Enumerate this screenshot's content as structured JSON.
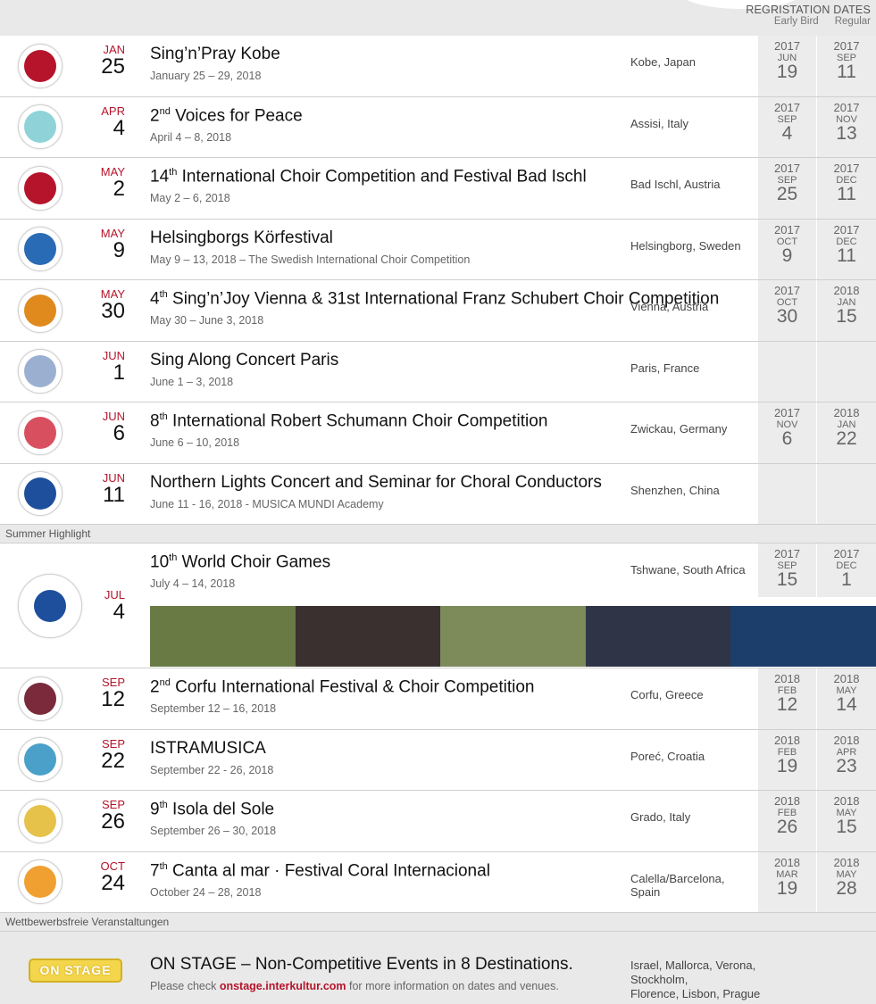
{
  "header": {
    "reg_title": "REGRISTATION DATES",
    "early_bird": "Early Bird",
    "regular": "Regular"
  },
  "events": [
    {
      "mon": "JAN",
      "day": "25",
      "title": "Sing’n’Pray Kobe",
      "sup": "",
      "rest": "",
      "sub": "January 25 – 29, 2018",
      "loc": "Kobe, Japan",
      "eb": {
        "y": "2017",
        "m": "JUN",
        "d": "19"
      },
      "rg": {
        "y": "2017",
        "m": "SEP",
        "d": "11"
      },
      "logo": "#b5142b"
    },
    {
      "mon": "APR",
      "day": "4",
      "title": "2",
      "sup": "nd",
      "rest": " Voices for Peace",
      "sub": "April 4 – 8, 2018",
      "loc": "Assisi, Italy",
      "eb": {
        "y": "2017",
        "m": "SEP",
        "d": "4"
      },
      "rg": {
        "y": "2017",
        "m": "NOV",
        "d": "13"
      },
      "logo": "#8fd3d9"
    },
    {
      "mon": "MAY",
      "day": "2",
      "title": "14",
      "sup": "th",
      "rest": " International Choir Competition and Festival Bad Ischl",
      "sub": "May 2 – 6, 2018",
      "loc": "Bad Ischl, Austria",
      "eb": {
        "y": "2017",
        "m": "SEP",
        "d": "25"
      },
      "rg": {
        "y": "2017",
        "m": "DEC",
        "d": "11"
      },
      "logo": "#b5142b"
    },
    {
      "mon": "MAY",
      "day": "9",
      "title": "Helsingborgs Körfestival",
      "sup": "",
      "rest": "",
      "sub": "May 9 – 13, 2018 – The Swedish International Choir Competition",
      "loc": "Helsingborg, Sweden",
      "eb": {
        "y": "2017",
        "m": "OCT",
        "d": "9"
      },
      "rg": {
        "y": "2017",
        "m": "DEC",
        "d": "11"
      },
      "logo": "#2a6bb5"
    },
    {
      "mon": "MAY",
      "day": "30",
      "title": "4",
      "sup": "th",
      "rest": " Sing’n’Joy Vienna & 31st International Franz Schubert Choir Competition",
      "sub": "May 30 – June 3, 2018",
      "loc": "Vienna, Austria",
      "eb": {
        "y": "2017",
        "m": "OCT",
        "d": "30"
      },
      "rg": {
        "y": "2018",
        "m": "JAN",
        "d": "15"
      },
      "logo": "#e08a1e"
    },
    {
      "mon": "JUN",
      "day": "1",
      "title": "Sing Along Concert Paris",
      "sup": "",
      "rest": "",
      "sub": "June 1 – 3, 2018",
      "loc": "Paris, France",
      "eb": null,
      "rg": null,
      "logo": "#9bb0d0"
    },
    {
      "mon": "JUN",
      "day": "6",
      "title": "8",
      "sup": "th",
      "rest": " International Robert Schumann Choir Competition",
      "sub": "June 6 – 10, 2018",
      "loc": "Zwickau, Germany",
      "eb": {
        "y": "2017",
        "m": "NOV",
        "d": "6"
      },
      "rg": {
        "y": "2018",
        "m": "JAN",
        "d": "22"
      },
      "logo": "#d85060"
    },
    {
      "mon": "JUN",
      "day": "11",
      "title": "Northern Lights Concert and Seminar for Choral Conductors",
      "sup": "",
      "rest": "",
      "sub": "June 11 - 16, 2018 - MUSICA MUNDI Academy",
      "loc": "Shenzhen, China",
      "eb": null,
      "rg": null,
      "logo": "#1d4f9c"
    }
  ],
  "summer_label": "Summer Highlight",
  "highlight": {
    "mon": "JUL",
    "day": "4",
    "title": "10",
    "sup": "th",
    "rest": " World Choir Games",
    "sub": "July 4 – 14, 2018",
    "loc": "Tshwane, South Africa",
    "eb": {
      "y": "2017",
      "m": "SEP",
      "d": "15"
    },
    "rg": {
      "y": "2017",
      "m": "DEC",
      "d": "1"
    }
  },
  "events2": [
    {
      "mon": "SEP",
      "day": "12",
      "title": "2",
      "sup": "nd",
      "rest": " Corfu International Festival & Choir Competition",
      "sub": "September 12 – 16, 2018",
      "loc": "Corfu, Greece",
      "eb": {
        "y": "2018",
        "m": "FEB",
        "d": "12"
      },
      "rg": {
        "y": "2018",
        "m": "MAY",
        "d": "14"
      },
      "logo": "#7a2a3a"
    },
    {
      "mon": "SEP",
      "day": "22",
      "title": "ISTRAMUSICA",
      "sup": "",
      "rest": "",
      "sub": "September 22 - 26, 2018",
      "loc": "Poreć, Croatia",
      "eb": {
        "y": "2018",
        "m": "FEB",
        "d": "19"
      },
      "rg": {
        "y": "2018",
        "m": "APR",
        "d": "23"
      },
      "logo": "#4aa0c8"
    },
    {
      "mon": "SEP",
      "day": "26",
      "title": "9",
      "sup": "th",
      "rest": " Isola del Sole",
      "sub": "September 26 – 30, 2018",
      "loc": "Grado, Italy",
      "eb": {
        "y": "2018",
        "m": "FEB",
        "d": "26"
      },
      "rg": {
        "y": "2018",
        "m": "MAY",
        "d": "15"
      },
      "logo": "#e6c24a"
    },
    {
      "mon": "OCT",
      "day": "24",
      "title": "7",
      "sup": "th",
      "rest": " Canta al mar · Festival Coral Internacional",
      "sub": "October 24 – 28, 2018",
      "loc": "Calella/Barcelona, Spain",
      "eb": {
        "y": "2018",
        "m": "MAR",
        "d": "19"
      },
      "rg": {
        "y": "2018",
        "m": "MAY",
        "d": "28"
      },
      "logo": "#f0a030"
    }
  ],
  "noncomp_label": "Wettbewerbsfreie Veranstaltungen",
  "onstage": {
    "badge": "ON STAGE",
    "title": "ON STAGE – Non-Competitive Events in 8 Destinations.",
    "sub_pre": "Please check ",
    "link": "onstage.interkultur.com",
    "sub_post": " for more information on dates and venues.",
    "loc1": "Israel, Mallorca, Verona, Stockholm,",
    "loc2": "Florence, Lisbon, Prague"
  }
}
